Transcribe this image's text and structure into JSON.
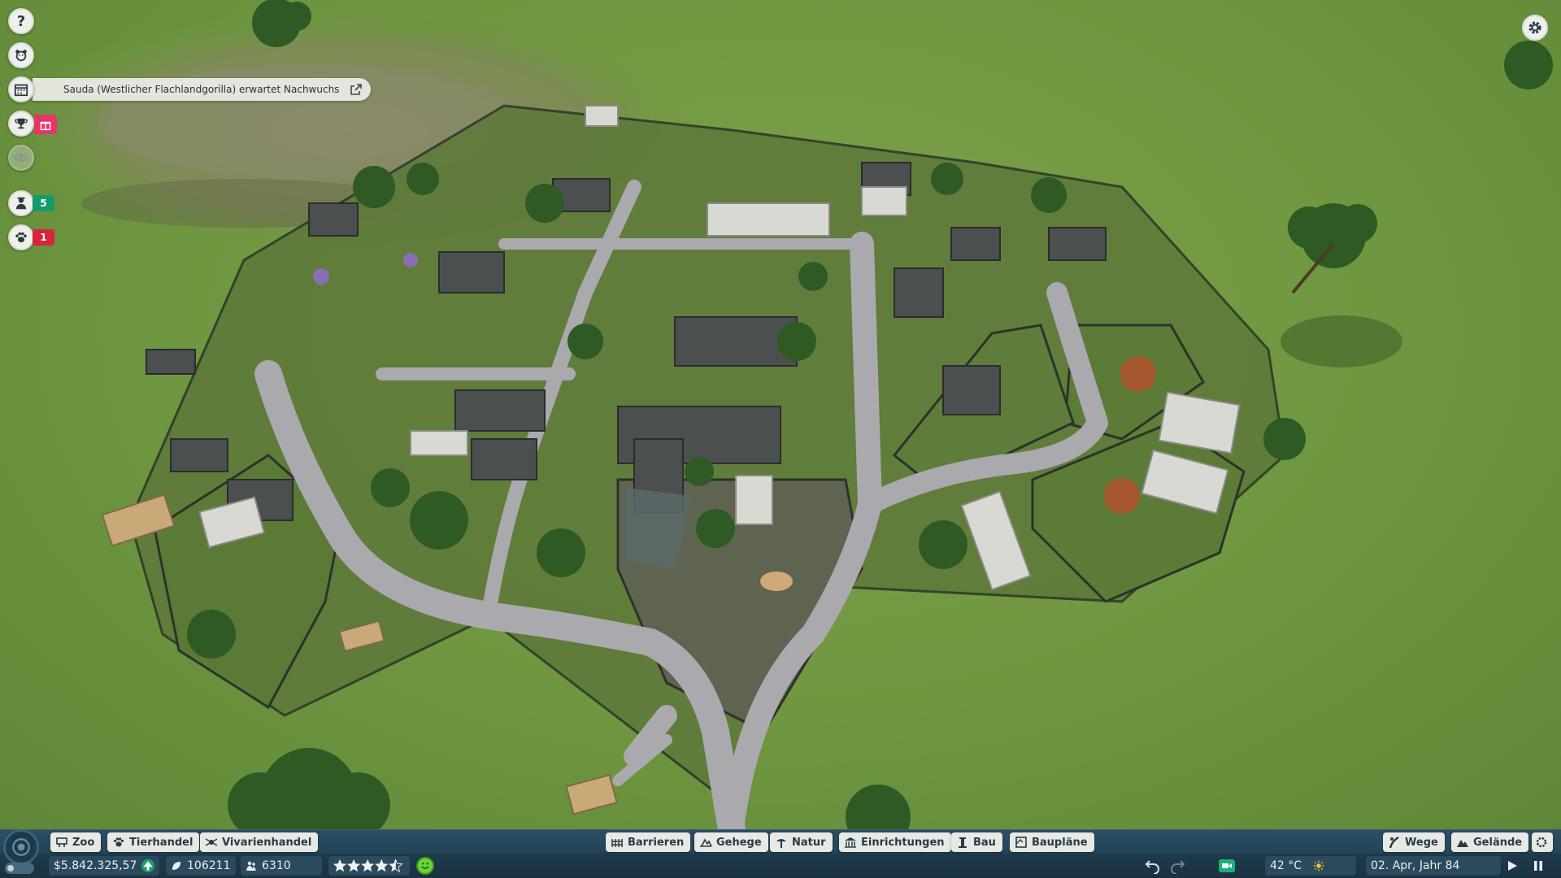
{
  "notification": {
    "text": "Sauda (Westlicher Flachlandgorilla) erwartet Nachwuchs"
  },
  "sidebar": {
    "staff_count": "5",
    "animal_alerts": "1"
  },
  "toolbar": {
    "left": [
      "Zoo",
      "Tierhandel",
      "Vivarienhandel"
    ],
    "center": [
      "Barrieren",
      "Gehege",
      "Natur",
      "Einrichtungen",
      "Bau",
      "Baupläne"
    ],
    "right": [
      "Wege",
      "Gelände"
    ]
  },
  "status": {
    "money": "$5.842.325,57",
    "conservation": "106211",
    "guests": "6310",
    "zoo_rating_stars": 4.5,
    "temperature": "42 °C",
    "date": "02. Apr, Jahr 84"
  },
  "colors": {
    "toolbar_bg": "#244457",
    "button_bg": "#e7e9e4",
    "badge_green": "#159a6a",
    "badge_red": "#d8243d",
    "gift": "#e83466"
  },
  "icons": [
    "help-icon",
    "animal-face-icon",
    "calendar-icon",
    "trophy-icon",
    "gift-icon",
    "eye-icon",
    "keeper-icon",
    "paw-icon",
    "gear-icon",
    "external-link-icon",
    "undo-icon",
    "redo-icon",
    "camera-icon",
    "sun-icon",
    "play-icon",
    "pause-icon"
  ]
}
